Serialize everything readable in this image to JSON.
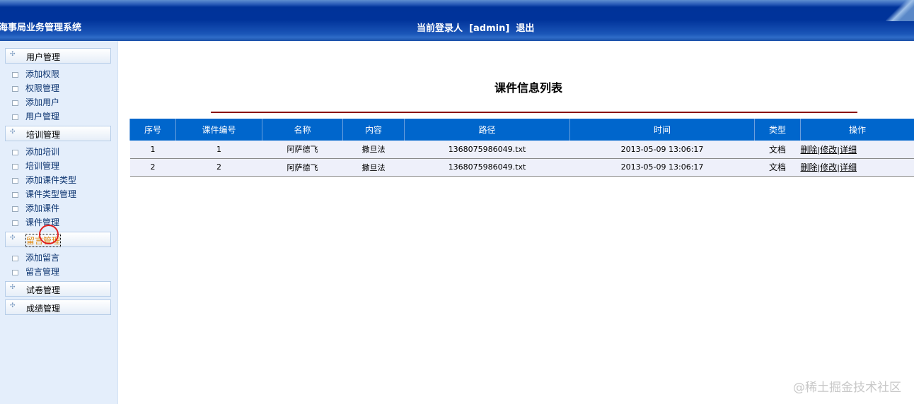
{
  "header": {
    "title": "海事局业务管理系统",
    "login_label": "当前登录人",
    "user": "[admin]",
    "logout": "退出"
  },
  "sidebar": {
    "groups": [
      {
        "label": "用户管理",
        "items": [
          "添加权限",
          "权限管理",
          "添加用户",
          "用户管理"
        ]
      },
      {
        "label": "培训管理",
        "items": [
          "添加培训",
          "培训管理",
          "添加课件类型",
          "课件类型管理",
          "添加课件",
          "课件管理"
        ]
      },
      {
        "label": "留言管理",
        "items": [
          "添加留言",
          "留言管理"
        ]
      },
      {
        "label": "试卷管理",
        "items": []
      },
      {
        "label": "成绩管理",
        "items": []
      }
    ]
  },
  "main": {
    "title": "课件信息列表",
    "columns": [
      "序号",
      "课件编号",
      "名称",
      "内容",
      "路径",
      "时间",
      "类型",
      "操作"
    ],
    "rows": [
      {
        "no": "1",
        "code": "1",
        "name": "阿萨德飞",
        "content": "撒旦法",
        "path": "1368075986049.txt",
        "time": "2013-05-09 13:06:17",
        "type": "文档"
      },
      {
        "no": "2",
        "code": "2",
        "name": "阿萨德飞",
        "content": "撒旦法",
        "path": "1368075986049.txt",
        "time": "2013-05-09 13:06:17",
        "type": "文档"
      }
    ],
    "actions": {
      "delete": "删除",
      "edit": "修改",
      "detail": "详细",
      "sep": "|"
    }
  },
  "watermark": "@稀土掘金技术社区"
}
